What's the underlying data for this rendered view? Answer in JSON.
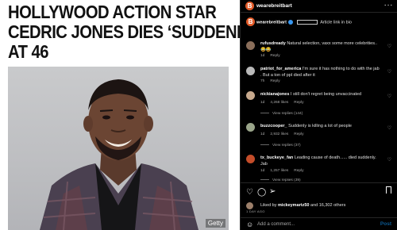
{
  "article": {
    "headline_lines": [
      "HOLLYWOOD ACTION STAR",
      "CEDRIC JONES DIES ‘SUDDENLY’",
      "AT 46"
    ],
    "photo_credit": "Getty"
  },
  "post": {
    "account": "wearebreitbart",
    "brand_initial": "B",
    "caption_user": "wearebreitbart",
    "caption_text": "Article link in bio",
    "more_icon": "ellipsis-icon",
    "accent_color": "#e35c2a",
    "verified_color": "#3897f0"
  },
  "comments": [
    {
      "user": "rufusdready",
      "text": "Natural selection, vaxx some more celebrities.. 😂😂",
      "time": "1d",
      "likes": "",
      "reply": "Reply",
      "replies": ""
    },
    {
      "user": "patriot_for_america",
      "text": "I'm sure it has nothing to do with the jab . But a ton of ppl died after it",
      "time": "7h",
      "likes": "",
      "reply": "Reply",
      "replies": ""
    },
    {
      "user": "nickianajones",
      "text": "I still don't regret being unvaccinated",
      "time": "1d",
      "likes": "4,268 likes",
      "reply": "Reply",
      "replies": "View replies (144)"
    },
    {
      "user": "buzzcooper_",
      "text": "Suddenly is killing a lot of people",
      "time": "1d",
      "likes": "2,932 likes",
      "reply": "Reply",
      "replies": "View replies (37)"
    },
    {
      "user": "tx_buckeye_fan",
      "text": "Leading cause of death...... died suddenly. Jab",
      "time": "1d",
      "likes": "1,257 likes",
      "reply": "Reply",
      "replies": "View replies (39)"
    }
  ],
  "actions": {
    "like_icon": "heart-icon",
    "comment_icon": "comment-icon",
    "share_icon": "share-icon",
    "save_icon": "bookmark-icon"
  },
  "likes_line": {
    "prefix": "Liked by",
    "user": "mickeymartz50",
    "suffix": "and 16,302 others"
  },
  "date": "1 DAY AGO",
  "composer": {
    "placeholder": "Add a comment...",
    "post_label": "Post",
    "emoji_icon": "smiley-icon"
  }
}
